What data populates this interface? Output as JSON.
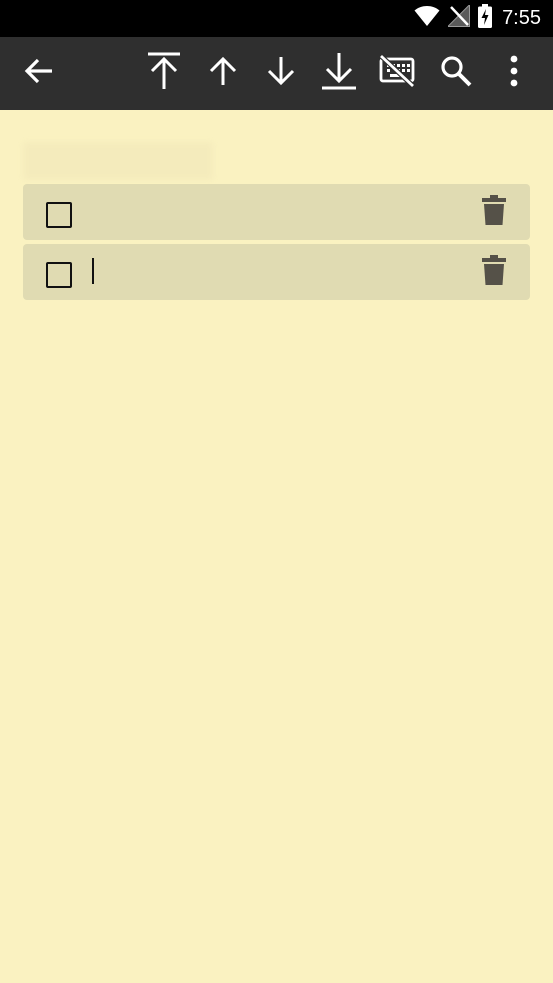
{
  "status_bar": {
    "time": "7:55",
    "icons": [
      "wifi-icon",
      "no-signal-icon",
      "battery-charging-icon"
    ]
  },
  "toolbar": {
    "buttons": [
      {
        "name": "back-button",
        "icon": "arrow-left-icon"
      },
      {
        "name": "move-to-top-button",
        "icon": "arrow-to-top-icon"
      },
      {
        "name": "move-up-button",
        "icon": "arrow-up-icon"
      },
      {
        "name": "move-down-button",
        "icon": "arrow-down-icon"
      },
      {
        "name": "move-to-bottom-button",
        "icon": "arrow-to-bottom-icon"
      },
      {
        "name": "hide-keyboard-button",
        "icon": "keyboard-off-icon"
      },
      {
        "name": "search-button",
        "icon": "search-icon"
      },
      {
        "name": "more-options-button",
        "icon": "more-vert-icon"
      }
    ]
  },
  "note": {
    "title": "",
    "items": [
      {
        "checked": false,
        "text": ""
      },
      {
        "checked": false,
        "text": "",
        "focused": true
      }
    ]
  },
  "colors": {
    "status_bar_bg": "#000000",
    "toolbar_bg": "#2f2f2f",
    "note_bg": "#faf2c1",
    "item_bg": "#e0dbb2",
    "icon_light": "#ffffff",
    "icon_dark": "#555148"
  }
}
